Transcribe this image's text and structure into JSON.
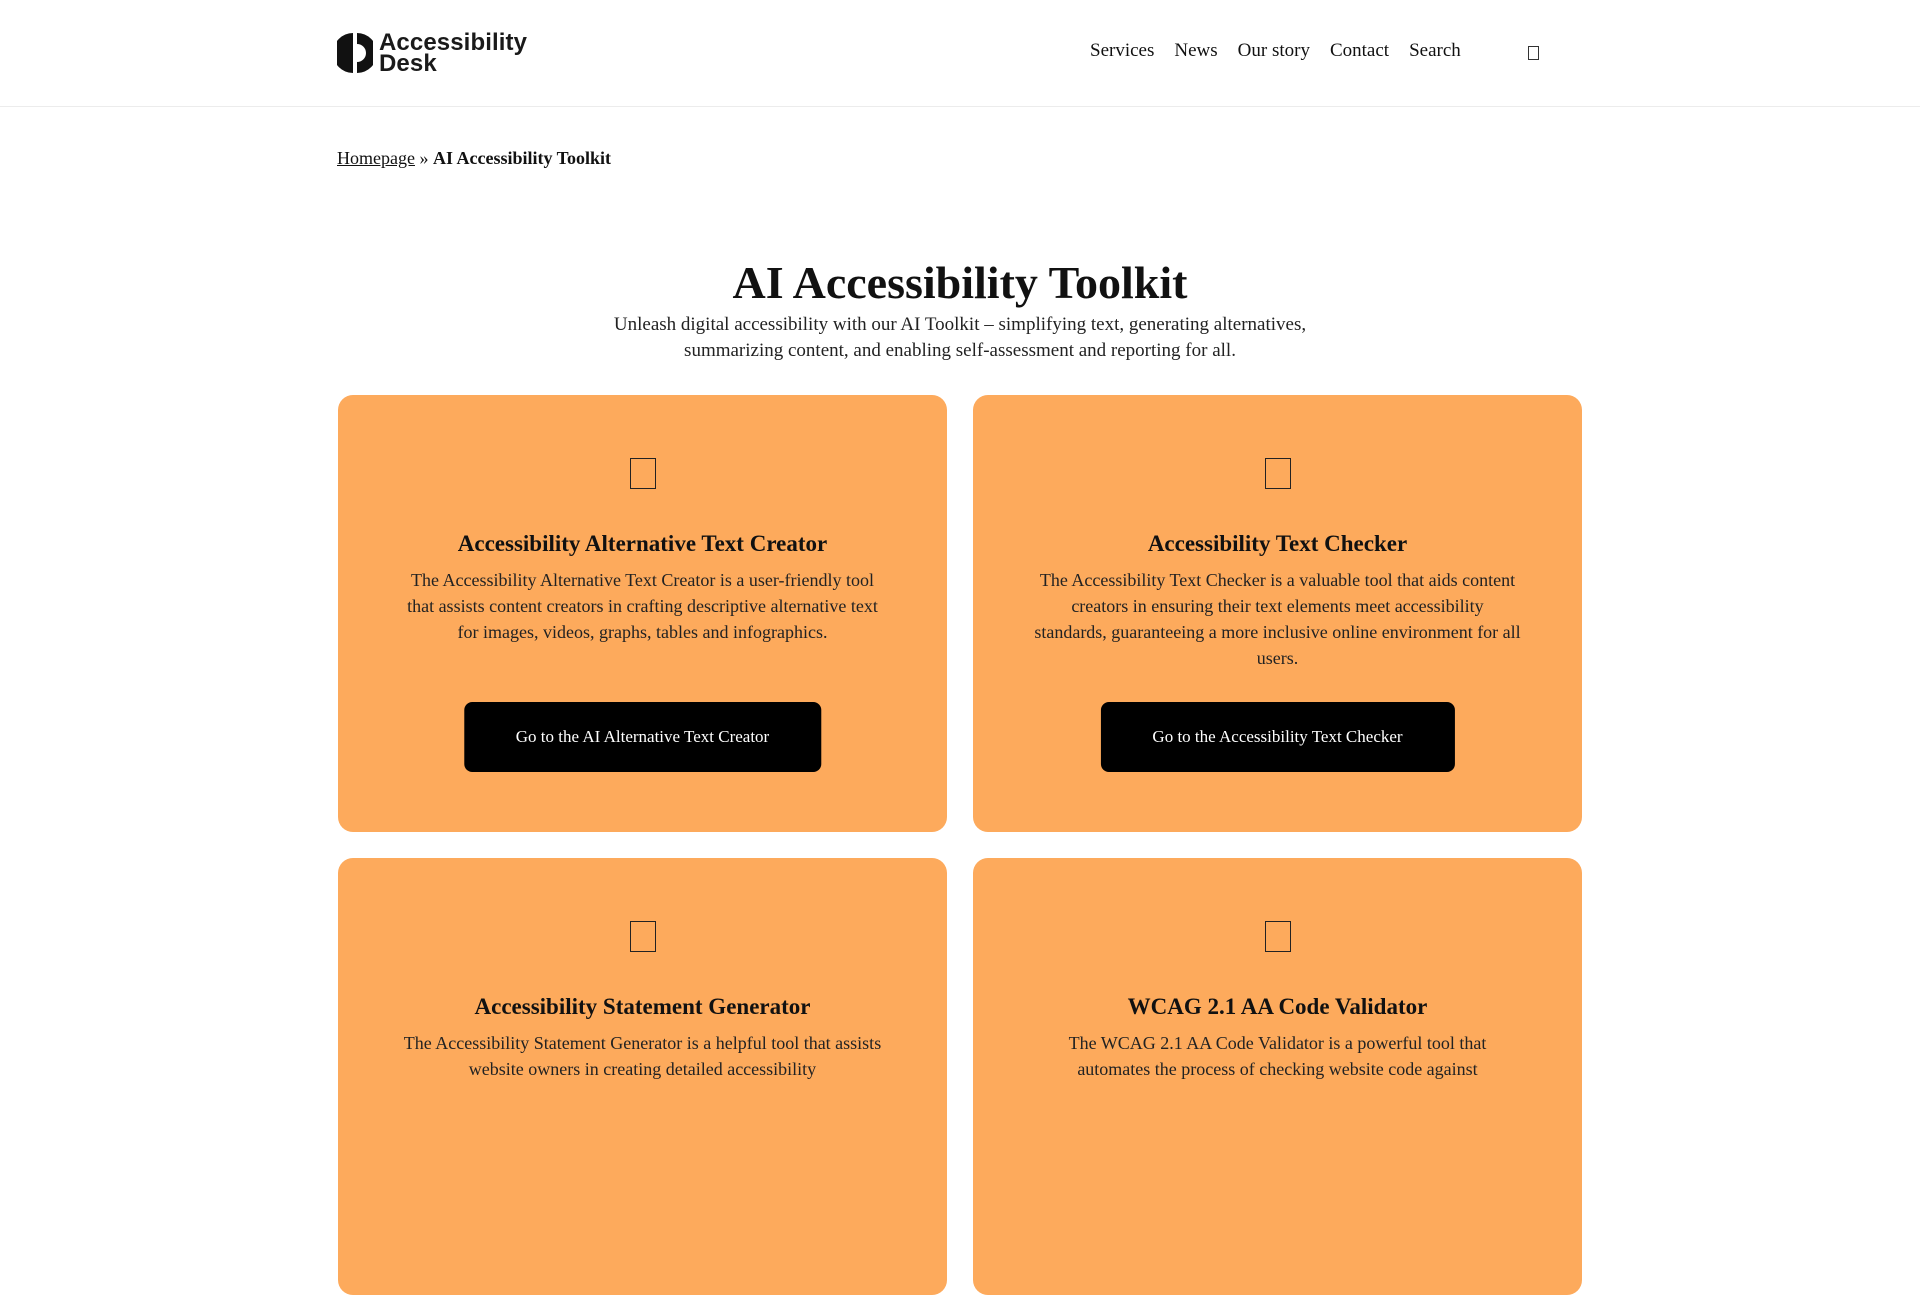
{
  "brand": {
    "name_line1": "Accessibility",
    "name_line2": "Desk"
  },
  "nav": {
    "items": [
      "Services",
      "News",
      "Our story",
      "Contact",
      "Search"
    ],
    "trailing_icon": "menu-icon"
  },
  "breadcrumb": {
    "home": "Homepage",
    "separator": "»",
    "current": "AI Accessibility Toolkit"
  },
  "hero": {
    "title": "AI Accessibility Toolkit",
    "subtitle": "Unleash digital accessibility with our AI Toolkit – simplifying text, generating alternatives, summarizing content, and enabling self-assessment and reporting for all."
  },
  "colors": {
    "card_background": "#fdaa5c",
    "button_background": "#000000",
    "button_text": "#ffffff"
  },
  "cards": [
    {
      "icon": "tool-icon",
      "title": "Accessibility Alternative Text Creator",
      "description": "The Accessibility Alternative Text Creator is a user-friendly tool that assists content creators in crafting descriptive alternative text for images, videos, graphs, tables and infographics.",
      "button": "Go to the AI Alternative Text Creator"
    },
    {
      "icon": "tool-icon",
      "title": "Accessibility Text Checker",
      "description": "The Accessibility Text Checker is a valuable tool that aids content creators in ensuring their text elements meet accessibility standards, guaranteeing a more inclusive online environment for all users.",
      "button": "Go to the Accessibility Text Checker"
    },
    {
      "icon": "tool-icon",
      "title": "Accessibility Statement Generator",
      "description": "The Accessibility Statement Generator is a helpful tool that assists website owners in creating detailed accessibility",
      "button": ""
    },
    {
      "icon": "tool-icon",
      "title": "WCAG 2.1 AA Code Validator",
      "description": "The WCAG 2.1 AA Code Validator is a powerful tool that automates the process of checking website code against",
      "button": ""
    }
  ]
}
